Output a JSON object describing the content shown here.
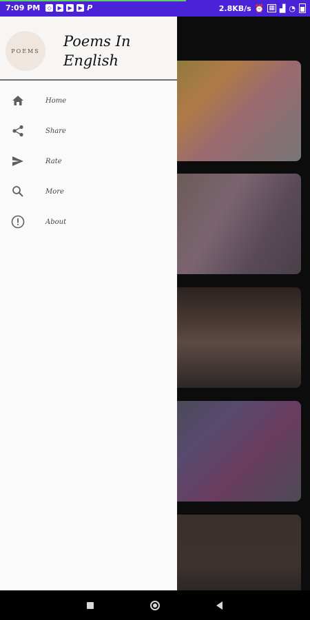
{
  "status_bar": {
    "time": "7:09 PM",
    "left_icons": [
      "sync-icon",
      "youtube-icon",
      "youtube-icon",
      "youtube-icon",
      "paypal-icon"
    ],
    "network_speed": "2.8KB/s",
    "right_icons": [
      "alarm-icon",
      "sim-icon",
      "signal-icon",
      "wifi-icon",
      "battery-icon"
    ],
    "color": "#4a23d8"
  },
  "drawer": {
    "logo_text": "POEMS",
    "app_title": "Poems In English",
    "menu_items": [
      {
        "label": "Home",
        "icon": "home-icon"
      },
      {
        "label": "Share",
        "icon": "share-icon"
      },
      {
        "label": "Rate",
        "icon": "send-icon"
      },
      {
        "label": "More",
        "icon": "search-icon"
      },
      {
        "label": "About",
        "icon": "info-icon"
      }
    ]
  },
  "nav_bar": {
    "buttons": [
      "recents-button",
      "home-button",
      "back-button"
    ]
  }
}
